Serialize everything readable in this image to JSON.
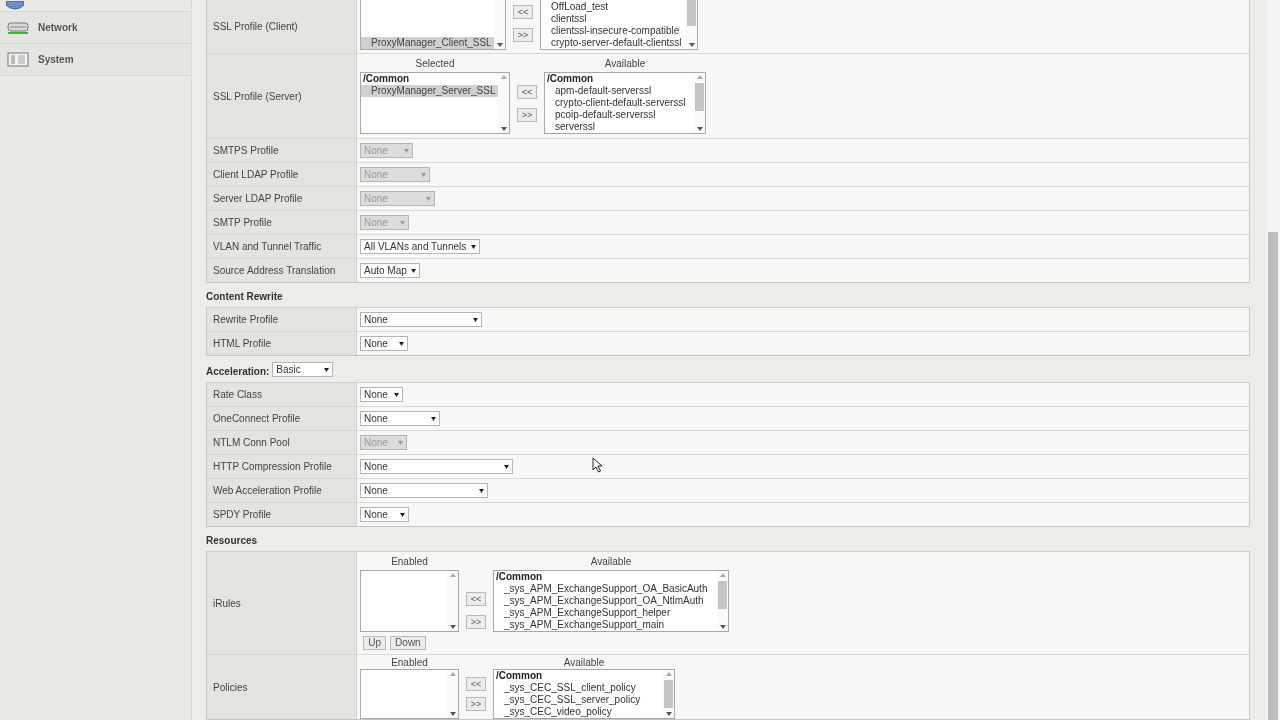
{
  "sidebar": {
    "items": [
      {
        "label": "Network"
      },
      {
        "label": "System"
      }
    ]
  },
  "sections": [
    {
      "rows": [
        {
          "kind": "dual_list",
          "label": "SSL Profile (Client)",
          "move_buttons": [
            "<<",
            ">>"
          ],
          "left": {
            "items": [
              {
                "kind": "option",
                "text": "ProxyManager_Client_SSL",
                "selected": true
              }
            ]
          },
          "right": {
            "items": [
              {
                "kind": "option",
                "text": "OffLoad_test",
                "selected": false
              },
              {
                "kind": "option",
                "text": "clientssl",
                "selected": false
              },
              {
                "kind": "option",
                "text": "clientssl-insecure-compatible",
                "selected": false
              },
              {
                "kind": "option",
                "text": "crypto-server-default-clientssl",
                "selected": false
              }
            ]
          }
        },
        {
          "kind": "dual_list",
          "label": "SSL Profile (Server)",
          "headers": [
            "Selected",
            "Available"
          ],
          "move_buttons": [
            "<<",
            ">>"
          ],
          "left": {
            "items": [
              {
                "kind": "group",
                "text": "/Common"
              },
              {
                "kind": "option",
                "text": "ProxyManager_Server_SSL",
                "selected": true
              }
            ]
          },
          "right": {
            "items": [
              {
                "kind": "group",
                "text": "/Common"
              },
              {
                "kind": "option",
                "text": "apm-default-serverssl",
                "selected": false
              },
              {
                "kind": "option",
                "text": "crypto-client-default-serverssl",
                "selected": false
              },
              {
                "kind": "option",
                "text": "pcoip-default-serverssl",
                "selected": false
              },
              {
                "kind": "option",
                "text": "serverssl",
                "selected": false
              }
            ]
          }
        },
        {
          "kind": "select",
          "label": "SMTPS Profile",
          "value": "None",
          "disabled": true
        },
        {
          "kind": "select",
          "label": "Client LDAP Profile",
          "value": "None",
          "disabled": true
        },
        {
          "kind": "select",
          "label": "Server LDAP Profile",
          "value": "None",
          "disabled": true
        },
        {
          "kind": "select",
          "label": "SMTP Profile",
          "value": "None",
          "disabled": true
        },
        {
          "kind": "select",
          "label": "VLAN and Tunnel Traffic",
          "value": "All VLANs and Tunnels",
          "disabled": false
        },
        {
          "kind": "select",
          "label": "Source Address Translation",
          "value": "Auto Map",
          "disabled": false
        }
      ]
    },
    {
      "title": "Content Rewrite",
      "rows": [
        {
          "kind": "select",
          "label": "Rewrite Profile",
          "value": "None",
          "disabled": false
        },
        {
          "kind": "select",
          "label": "HTML Profile",
          "value": "None",
          "disabled": false
        }
      ]
    },
    {
      "title": "Acceleration:",
      "title_select": {
        "value": "Basic",
        "disabled": false
      },
      "rows": [
        {
          "kind": "select",
          "label": "Rate Class",
          "value": "None",
          "disabled": false
        },
        {
          "kind": "select",
          "label": "OneConnect Profile",
          "value": "None",
          "disabled": false
        },
        {
          "kind": "select",
          "label": "NTLM Conn Pool",
          "value": "None",
          "disabled": true
        },
        {
          "kind": "select",
          "label": "HTTP Compression Profile",
          "value": "None",
          "disabled": false
        },
        {
          "kind": "select",
          "label": "Web Acceleration Profile",
          "value": "None",
          "disabled": false
        },
        {
          "kind": "select",
          "label": "SPDY Profile",
          "value": "None",
          "disabled": false
        }
      ]
    },
    {
      "title": "Resources",
      "rows": [
        {
          "kind": "dual_list",
          "label": "iRules",
          "headers": [
            "Enabled",
            "Available"
          ],
          "move_buttons": [
            "<<",
            ">>"
          ],
          "order_buttons": [
            "Up",
            "Down"
          ],
          "right": {
            "items": [
              {
                "kind": "group",
                "text": "/Common"
              },
              {
                "kind": "option",
                "text": "_sys_APM_ExchangeSupport_OA_BasicAuth",
                "selected": false
              },
              {
                "kind": "option",
                "text": "_sys_APM_ExchangeSupport_OA_NtlmAuth",
                "selected": false
              },
              {
                "kind": "option",
                "text": "_sys_APM_ExchangeSupport_helper",
                "selected": false
              },
              {
                "kind": "option",
                "text": "_sys_APM_ExchangeSupport_main",
                "selected": false
              }
            ]
          }
        },
        {
          "kind": "dual_list",
          "label": "Policies",
          "headers": [
            "Enabled",
            "Available"
          ],
          "move_buttons": [
            "<<",
            ">>"
          ],
          "right": {
            "items": [
              {
                "kind": "group",
                "text": "/Common"
              },
              {
                "kind": "option",
                "text": "_sys_CEC_SSL_client_policy",
                "selected": false
              },
              {
                "kind": "option",
                "text": "_sys_CEC_SSL_server_policy",
                "selected": false
              },
              {
                "kind": "option",
                "text": "_sys_CEC_video_policy",
                "selected": false
              }
            ]
          }
        }
      ]
    }
  ]
}
